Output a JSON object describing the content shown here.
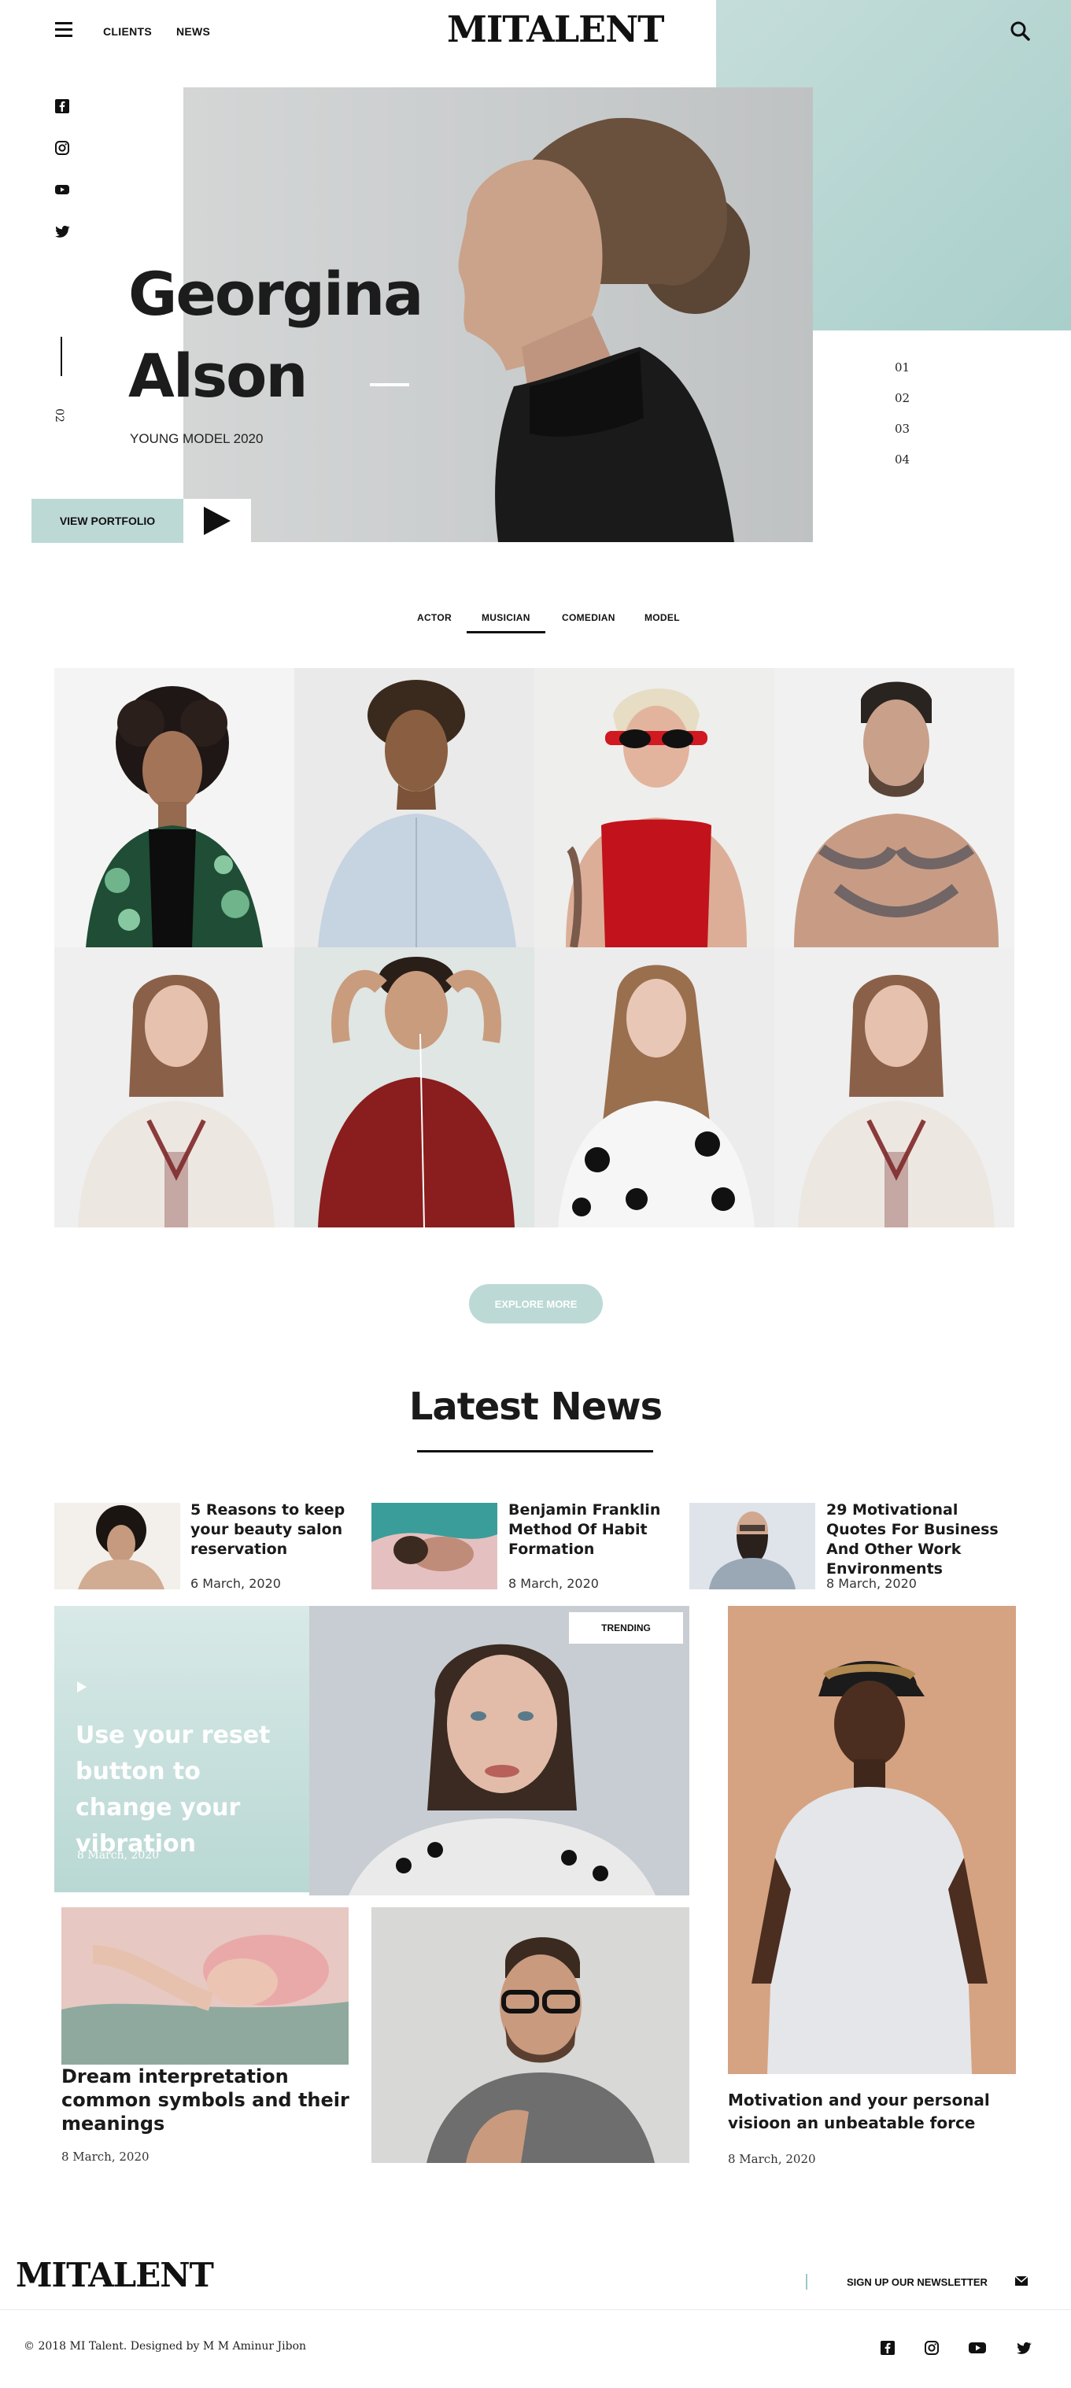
{
  "header": {
    "nav": [
      "CLIENTS",
      "NEWS"
    ],
    "logo": "MITALENT"
  },
  "hero": {
    "vertical_index": "02",
    "name_line1": "Georgina",
    "name_line2": "Alson",
    "subtitle": "YOUNG MODEL 2020",
    "cta_label": "VIEW PORTFOLIO",
    "slides": [
      "01",
      "02",
      "03",
      "04"
    ]
  },
  "tabs": {
    "items": [
      "ACTOR",
      "MUSICIAN",
      "COMEDIAN",
      "MODEL"
    ],
    "active": "MUSICIAN"
  },
  "gallery": {
    "button_label": "EXPLORE MORE"
  },
  "news": {
    "heading": "Latest News",
    "small_items": [
      {
        "title": "5 Reasons to keep your beauty salon reservation",
        "date": "6 March, 2020"
      },
      {
        "title": "Benjamin Franklin Method Of Habit Formation",
        "date": "8 March, 2020"
      },
      {
        "title": "29 Motivational Quotes For Business And Other Work Environments",
        "date": "8 March, 2020"
      }
    ],
    "feature": {
      "badge": "TRENDING",
      "title": "Use your reset button to change your vibration",
      "date": "8 March, 2020"
    },
    "card_left": {
      "title": "Dream interpretation common symbols and their meanings",
      "date": "8 March, 2020"
    },
    "card_right": {
      "title": "Motivation and your personal visioon an unbeatable force",
      "date": "8 March, 2020"
    }
  },
  "footer": {
    "logo": "MITALENT",
    "newsletter": "SIGN UP OUR NEWSLETTER",
    "copyright": "© 2018 MI Talent. Designed by M M Aminur Jibon"
  },
  "colors": {
    "accent_teal": "#bcd9d6",
    "dark": "#111111"
  }
}
